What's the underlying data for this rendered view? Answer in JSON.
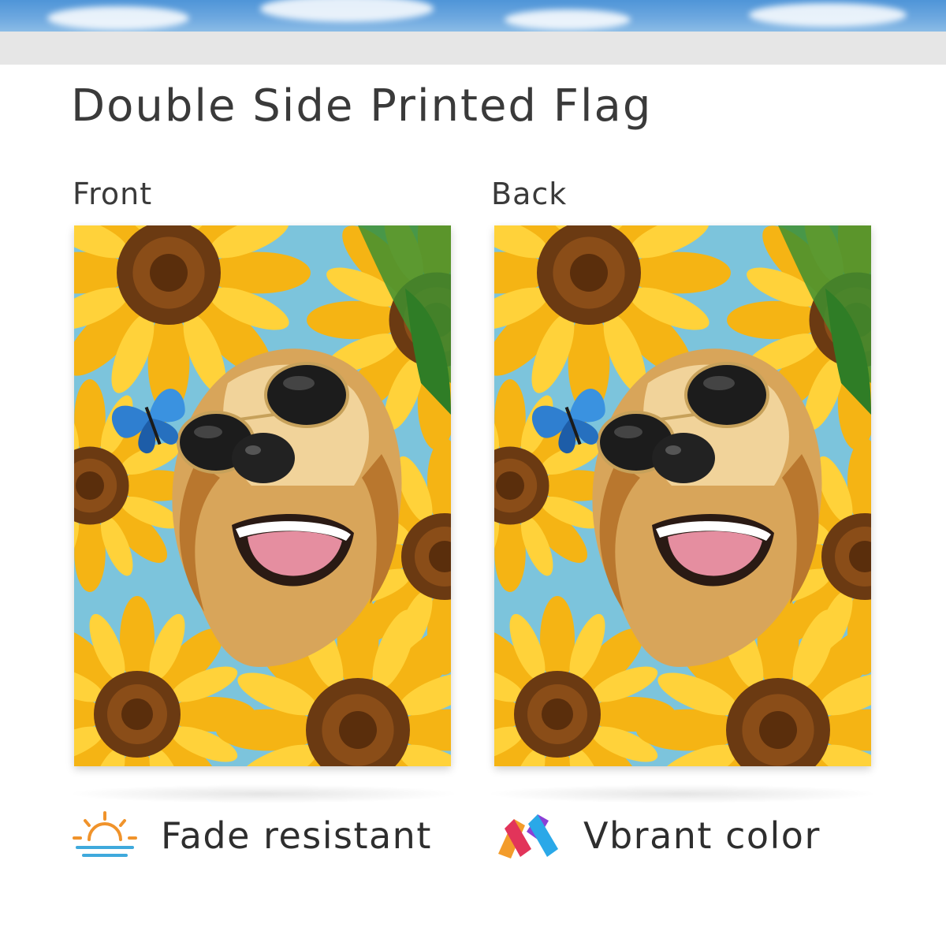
{
  "title": "Double Side Printed Flag",
  "sides": {
    "front": "Front",
    "back": "Back"
  },
  "features": {
    "fade": {
      "label": "Fade resistant",
      "icon": "sun-horizon-icon"
    },
    "vibrant": {
      "label": "Vbrant color",
      "icon": "color-ribbon-icon"
    }
  },
  "colors": {
    "sky": "#4f95d8",
    "strip": "#e6e6e6",
    "flag_background": "#7cc4dc",
    "sunflower_petal": "#f5b414",
    "sunflower_center": "#6b3a12",
    "sun_orange": "#f0932b",
    "horizon_blue": "#3fa9dc"
  }
}
